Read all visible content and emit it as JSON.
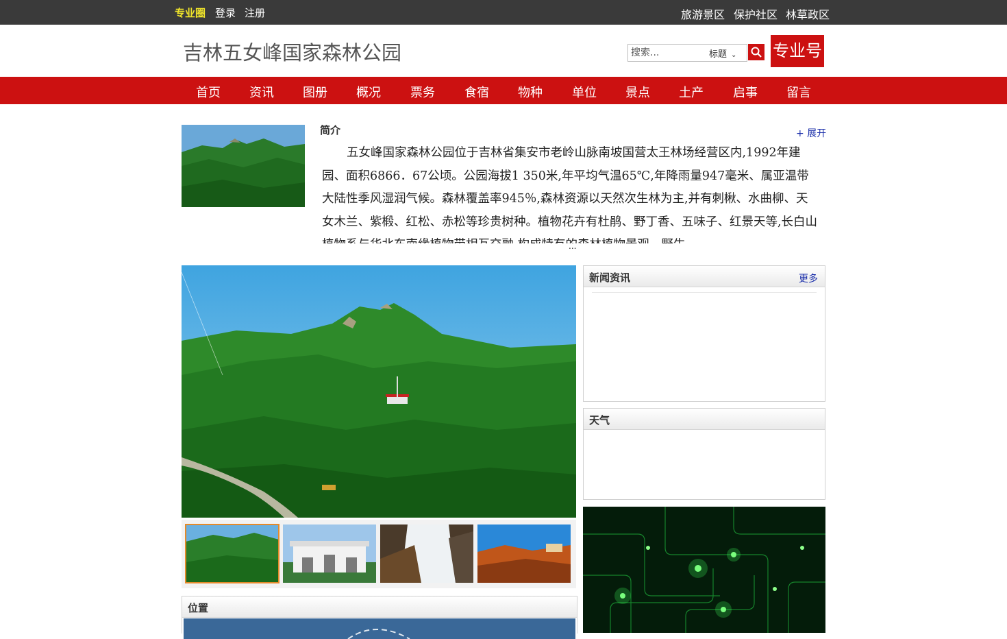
{
  "topbar": {
    "brand": "专业圈",
    "login": "登录",
    "register": "注册",
    "right_links": [
      "旅游景区",
      "保护社区",
      "林草政区"
    ]
  },
  "header": {
    "site_title": "吉林五女峰国家森林公园",
    "search_placeholder": "搜索...",
    "search_scope": "标题",
    "badge": "专业号"
  },
  "nav": [
    "首页",
    "资讯",
    "图册",
    "概况",
    "票务",
    "食宿",
    "物种",
    "单位",
    "景点",
    "土产",
    "启事",
    "留言"
  ],
  "intro": {
    "title": "简介",
    "expand": "+ 展开",
    "text": "五女峰国家森林公园位于吉林省集安市老岭山脉南坡国营太王林场经营区内,1992年建园、面积6866．67公顷。公园海拔1 350米,年平均气温65℃,年降雨量947毫米、属亚温带大陆性季风湿润气候。森林覆盖率945％,森林资源以天然次生林为主,并有刺楸、水曲柳、天女木兰、紫椴、红松、赤松等珍贵树种。植物花卉有杜鹃、野丁香、五味子、红景天等,长白山植物系与华北东南缘植物带相互交融,构成特有的森林植物景观。野生",
    "more": "..."
  },
  "panels": {
    "news_title": "新闻资讯",
    "news_more": "更多",
    "weather_title": "天气",
    "location_title": "位置"
  },
  "colors": {
    "brand_red": "#cc1111",
    "topbar_bg": "#3a3a3a",
    "brand_yellow": "#f0e52a",
    "link_blue": "#1a2eaa",
    "thumb_active": "#e48a2a"
  }
}
